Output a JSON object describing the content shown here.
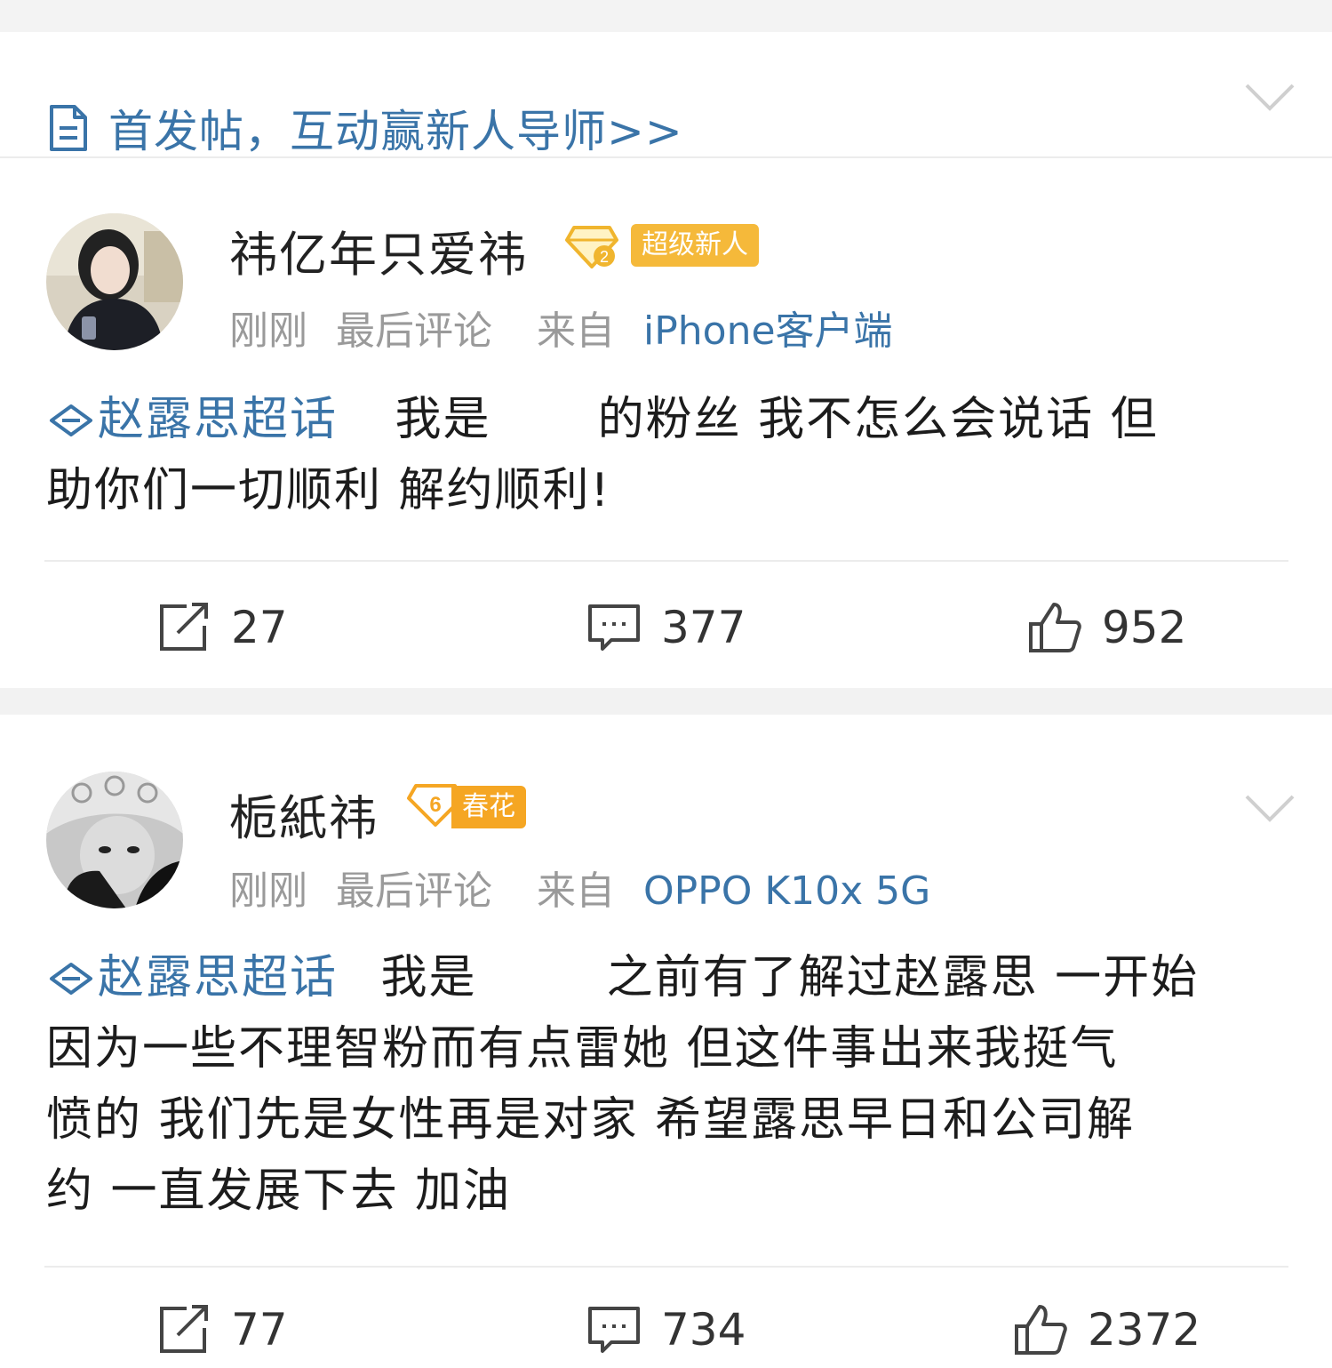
{
  "banner": {
    "text": "首发帖，互动赢新人导师>>",
    "icon": "document-icon",
    "expand_icon": "chevron-down-icon"
  },
  "posts": [
    {
      "username": "祎亿年只爱祎",
      "level_icon": "diamond-level-badge-icon",
      "rank_tag": "超级新人",
      "rank_color": "#f5b93a",
      "time": "刚刚",
      "activity": "最后评论",
      "source_prefix": "来自",
      "source": "iPhone客户端",
      "topic": "赵露思超话",
      "content_a": "我是",
      "content_b": "的粉丝 我不怎么会说话 但",
      "content_c": "助你们一切顺利 解约顺利!",
      "reposts": "27",
      "comments": "377",
      "likes": "952"
    },
    {
      "username": "栀紙祎",
      "level_icon": "level-6-badge-icon",
      "level_number": "6",
      "rank_tag": "春花",
      "rank_color": "#f5a623",
      "time": "刚刚",
      "activity": "最后评论",
      "source_prefix": "来自",
      "source": "OPPO K10x 5G",
      "topic": "赵露思超话",
      "content_a": "我是",
      "content_b": "之前有了解过赵露思 一开始",
      "content_c": "因为一些不理智粉而有点雷她 但这件事出来我挺气",
      "content_d": "愤的 我们先是女性再是对家 希望露思早日和公司解",
      "content_e": "约 一直发展下去 加油",
      "reposts": "77",
      "comments": "734",
      "likes": "2372"
    }
  ],
  "colors": {
    "link_blue": "#3a74a8",
    "meta_gray": "#9a9a9a",
    "divider": "#ececec"
  }
}
